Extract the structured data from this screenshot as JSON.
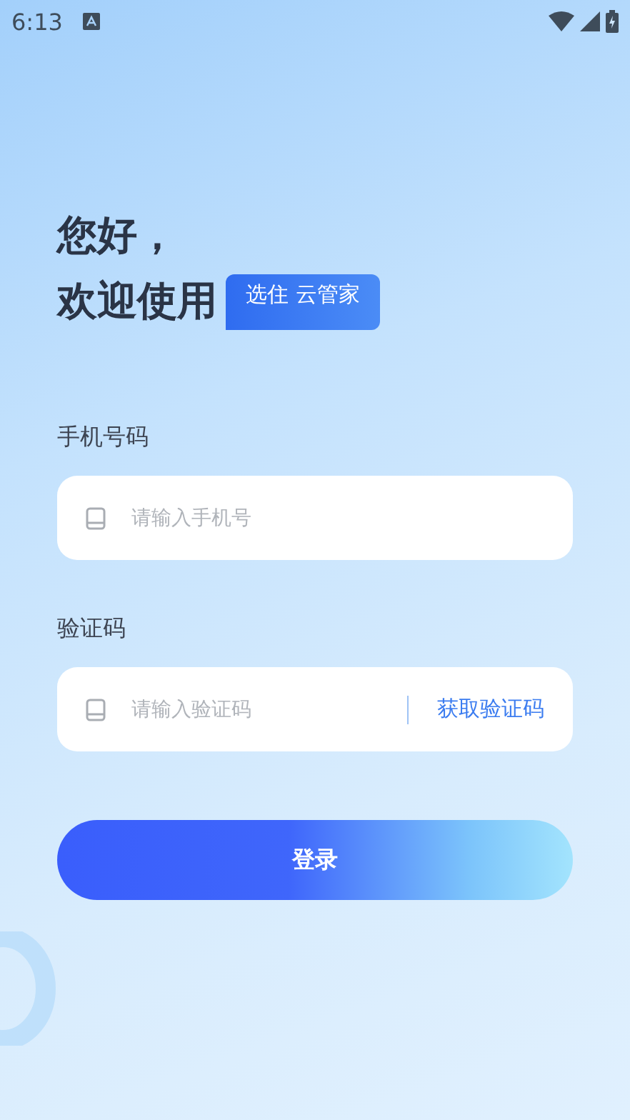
{
  "status_bar": {
    "time": "6:13"
  },
  "greeting": {
    "line_1": "您好，",
    "line_2": "欢迎使用",
    "brand": "选住 云管家"
  },
  "phone": {
    "label": "手机号码",
    "placeholder": "请输入手机号"
  },
  "code": {
    "label": "验证码",
    "placeholder": "请输入验证码",
    "action": "获取验证码"
  },
  "login_button": "登录"
}
